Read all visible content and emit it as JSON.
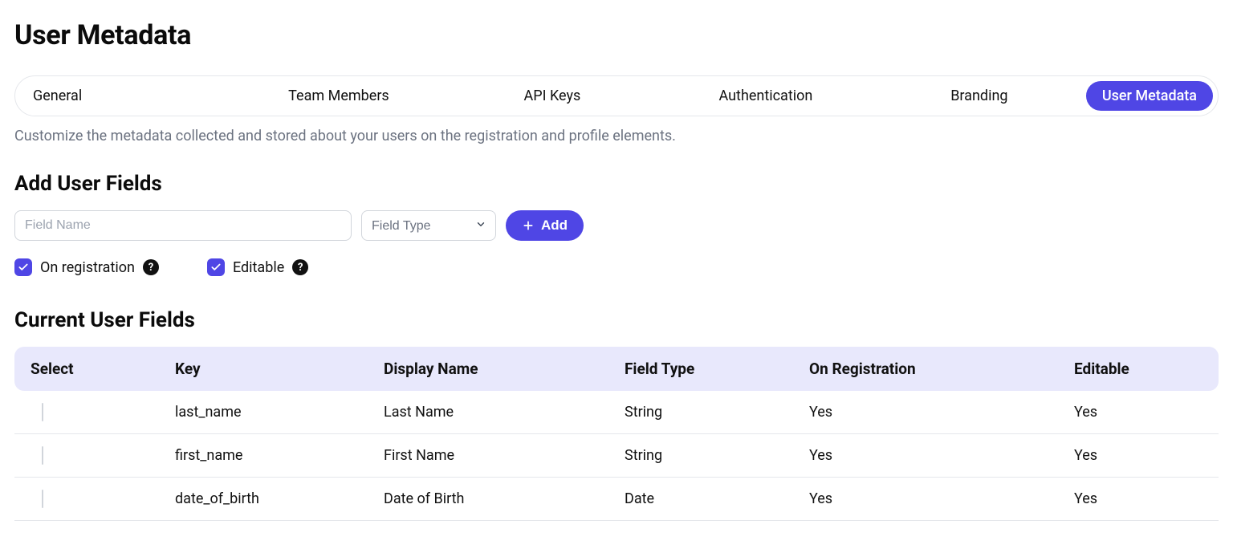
{
  "page": {
    "title": "User Metadata"
  },
  "tabs": {
    "items": [
      {
        "label": "General"
      },
      {
        "label": "Team Members"
      },
      {
        "label": "API Keys"
      },
      {
        "label": "Authentication"
      },
      {
        "label": "Branding"
      },
      {
        "label": "User Metadata"
      }
    ],
    "active_index": 5
  },
  "subtitle": "Customize the metadata collected and stored about your users on the registration and profile elements.",
  "add_section": {
    "title": "Add User Fields",
    "field_name_placeholder": "Field Name",
    "field_type_placeholder": "Field Type",
    "add_button_label": "Add",
    "checkboxes": {
      "on_registration": {
        "label": "On registration",
        "checked": true
      },
      "editable": {
        "label": "Editable",
        "checked": true
      }
    }
  },
  "table": {
    "title": "Current User Fields",
    "headers": {
      "select": "Select",
      "key": "Key",
      "display_name": "Display Name",
      "field_type": "Field Type",
      "on_registration": "On Registration",
      "editable": "Editable"
    },
    "rows": [
      {
        "key": "last_name",
        "display_name": "Last Name",
        "field_type": "String",
        "on_registration": "Yes",
        "editable": "Yes"
      },
      {
        "key": "first_name",
        "display_name": "First Name",
        "field_type": "String",
        "on_registration": "Yes",
        "editable": "Yes"
      },
      {
        "key": "date_of_birth",
        "display_name": "Date of Birth",
        "field_type": "Date",
        "on_registration": "Yes",
        "editable": "Yes"
      }
    ]
  }
}
